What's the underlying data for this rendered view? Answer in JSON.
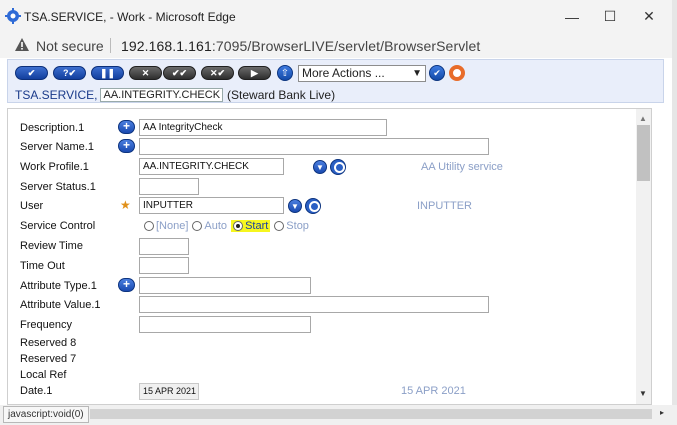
{
  "window": {
    "title": "TSA.SERVICE, - Work - Microsoft Edge",
    "minimize": "—",
    "maximize": "☐",
    "close": "✕"
  },
  "address_bar": {
    "security_label": "Not secure",
    "url_host": "192.168.1.161",
    "url_rest": ":7095/BrowserLIVE/servlet/BrowserServlet"
  },
  "toolbar": {
    "buttons": [
      {
        "icon": "commit-icon",
        "glyph": "✔"
      },
      {
        "icon": "validate-icon",
        "glyph": "?✔"
      },
      {
        "icon": "hold-icon",
        "glyph": "❚❚"
      },
      {
        "icon": "delete-icon",
        "glyph": "✕"
      },
      {
        "icon": "authorise-icon",
        "glyph": "✔✔"
      },
      {
        "icon": "reverse-icon",
        "glyph": "✕✔"
      },
      {
        "icon": "next-icon",
        "glyph": "▶"
      }
    ],
    "up_glyph": "⇧",
    "more_actions": "More Actions ...",
    "more_actions_caret": "▼",
    "go_glyph": "✔"
  },
  "breadcrumb": {
    "application": "TSA.SERVICE,",
    "record_id": "AA.INTEGRITY.CHECK",
    "company": "(Steward Bank Live)"
  },
  "form": {
    "description_label": "Description.1",
    "description_value": "AA IntegrityCheck",
    "server_name_label": "Server Name.1",
    "server_name_value": "",
    "work_profile_label": "Work Profile.1",
    "work_profile_value": "AA.INTEGRITY.CHECK",
    "work_profile_enrichment": "AA Utility service",
    "server_status_label": "Server Status.1",
    "server_status_value": "",
    "user_label": "User",
    "user_required": "★",
    "user_value": "INPUTTER",
    "user_enrichment": "INPUTTER",
    "service_control_label": "Service Control",
    "service_control_options": [
      "[None]",
      "Auto",
      "Start",
      "Stop"
    ],
    "service_control_selected": "Start",
    "review_time_label": "Review Time",
    "review_time_value": "",
    "time_out_label": "Time Out",
    "time_out_value": "",
    "attribute_type_label": "Attribute Type.1",
    "attribute_type_value": "",
    "attribute_value_label": "Attribute Value.1",
    "attribute_value_value": "",
    "frequency_label": "Frequency",
    "frequency_value": "",
    "reserved8_label": "Reserved 8",
    "reserved7_label": "Reserved 7",
    "local_ref_label": "Local Ref",
    "date_label": "Date.1",
    "date_value": "15 APR 2021",
    "date_enrichment": "15 APR 2021",
    "expand_glyph": "+"
  },
  "status_bar": {
    "text": "javascript:void(0)",
    "scroll_right": "▸"
  },
  "scrollbar": {
    "up": "▲",
    "down": "▼"
  },
  "colors": {
    "toolbar_button": "#1a4ab0",
    "enrichment_text": "#8b9fc7",
    "highlight": "#f6f61f"
  }
}
